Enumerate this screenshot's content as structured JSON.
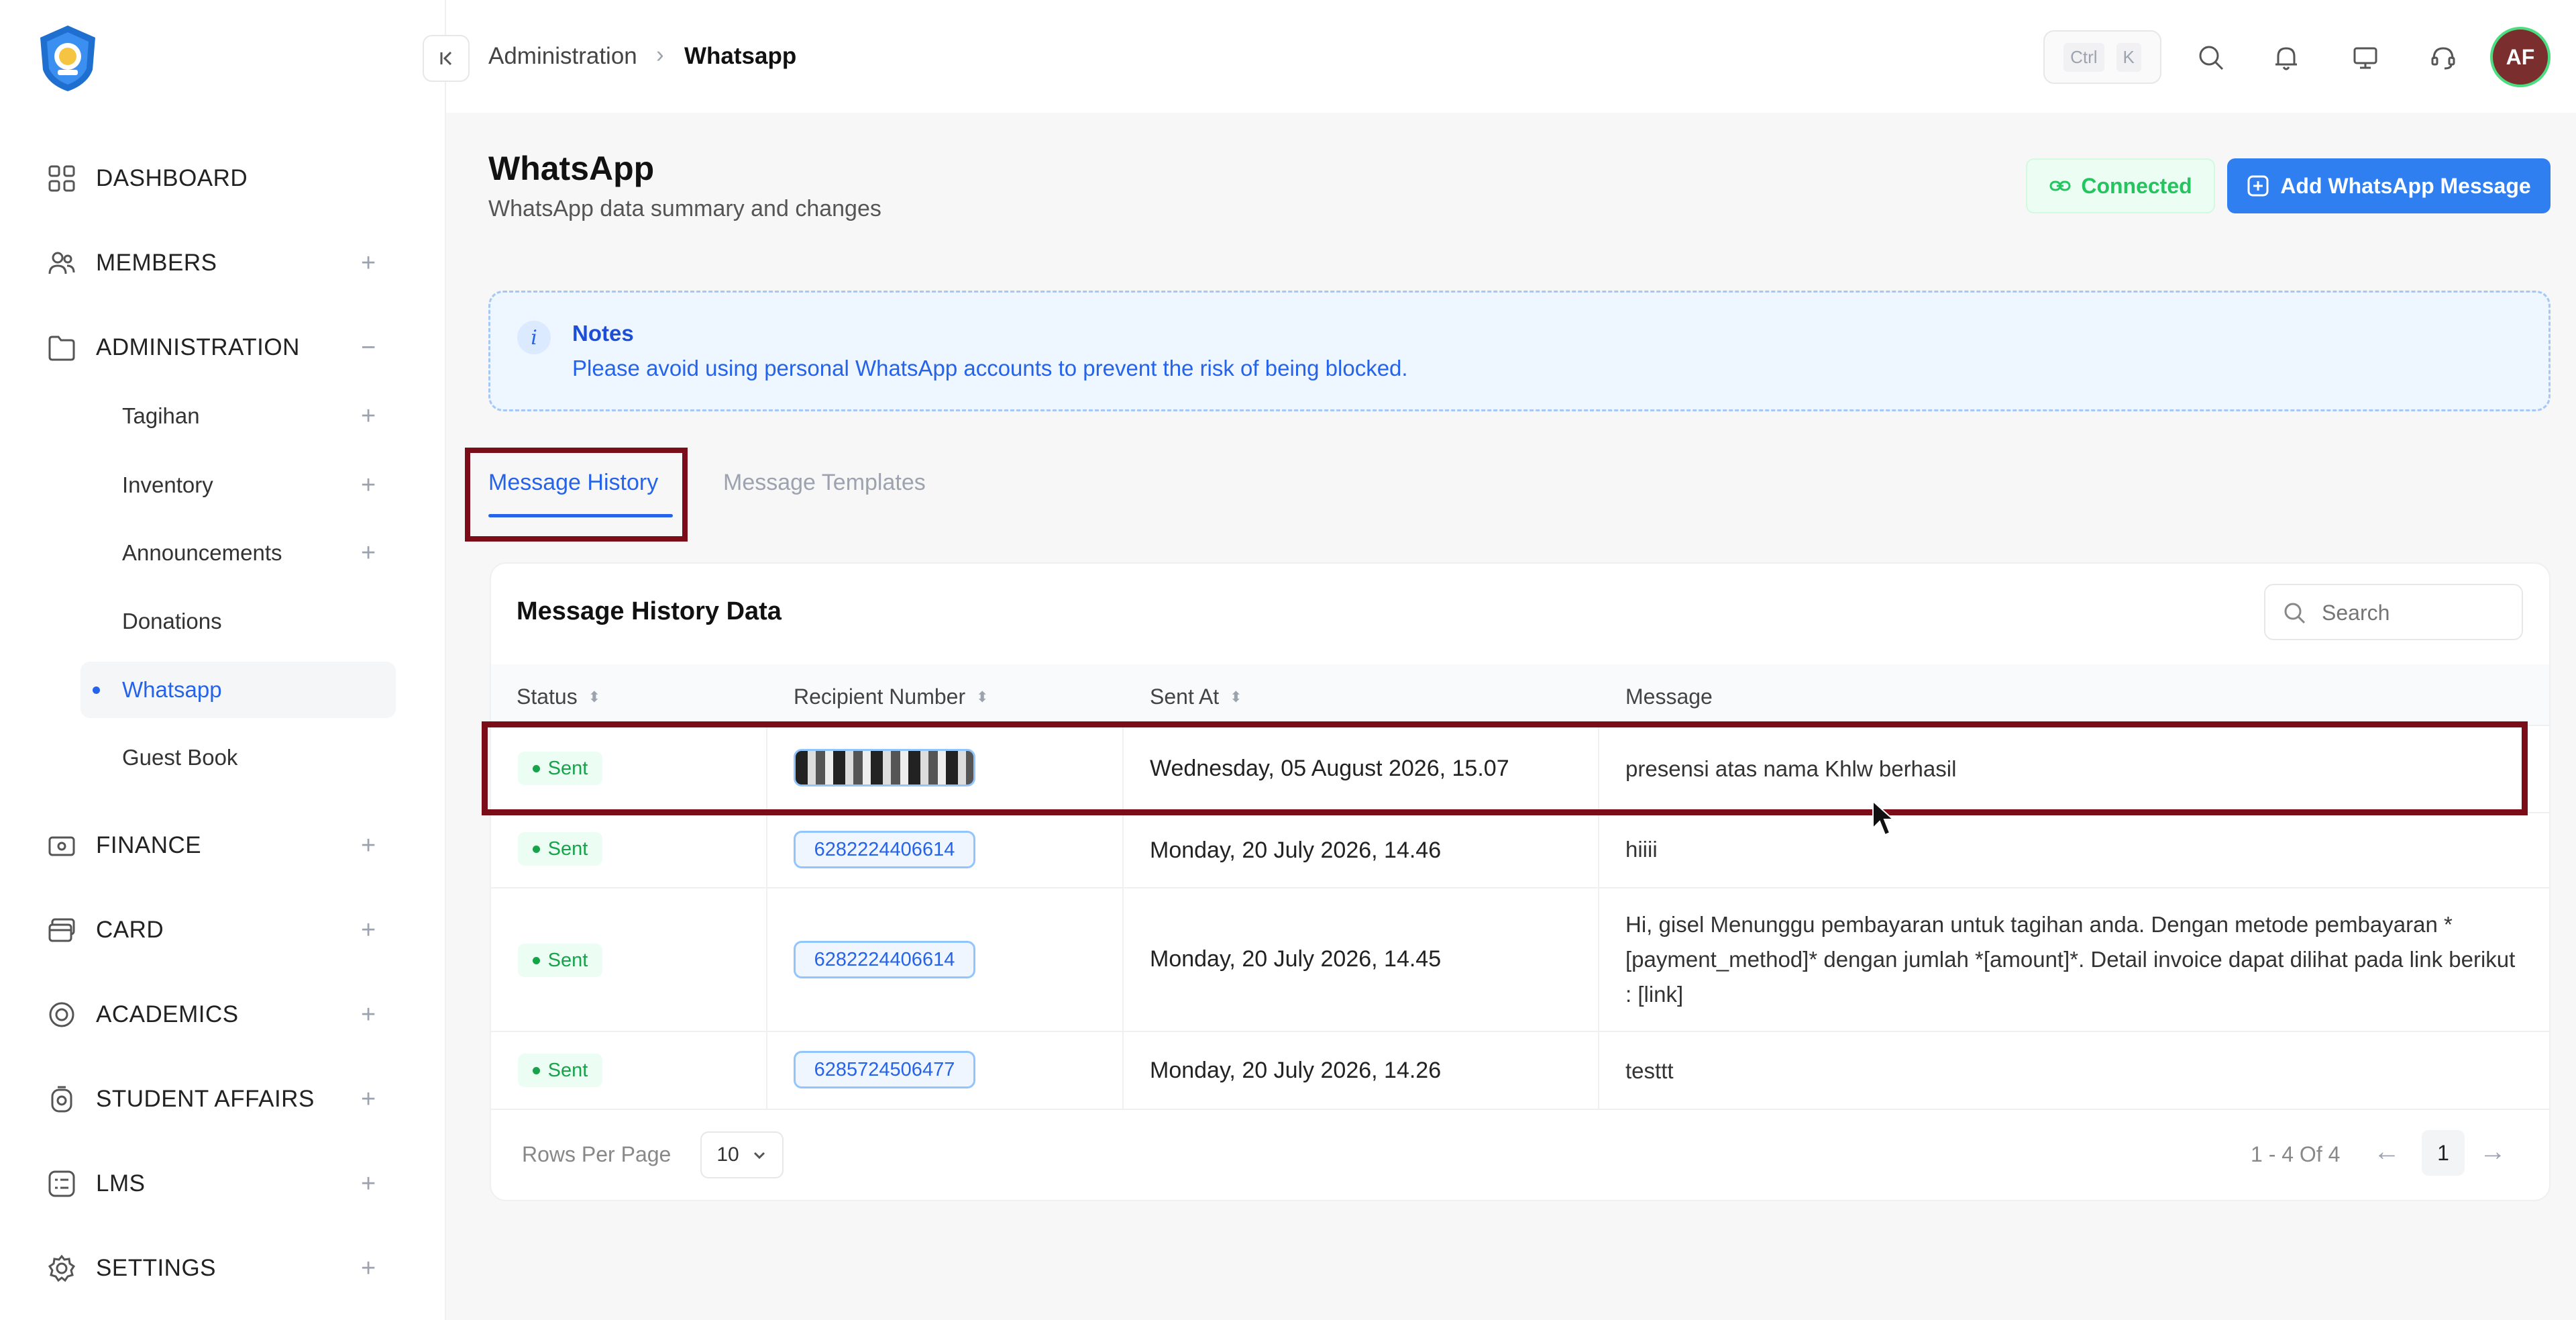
{
  "sidebar": {
    "items": [
      {
        "label": "DASHBOARD",
        "icon": "dashboard-icon"
      },
      {
        "label": "MEMBERS",
        "icon": "members-icon",
        "toggle": "+"
      },
      {
        "label": "ADMINISTRATION",
        "icon": "folder-icon",
        "toggle": "−"
      },
      {
        "label": "FINANCE",
        "icon": "finance-icon",
        "toggle": "+"
      },
      {
        "label": "CARD",
        "icon": "card-icon",
        "toggle": "+"
      },
      {
        "label": "ACADEMICS",
        "icon": "academics-icon",
        "toggle": "+"
      },
      {
        "label": "STUDENT AFFAIRS",
        "icon": "student-affairs-icon",
        "toggle": "+"
      },
      {
        "label": "LMS",
        "icon": "lms-icon",
        "toggle": "+"
      },
      {
        "label": "SETTINGS",
        "icon": "settings-icon",
        "toggle": "+"
      }
    ],
    "sub_items": [
      {
        "label": "Tagihan",
        "toggle": "+"
      },
      {
        "label": "Inventory",
        "toggle": "+"
      },
      {
        "label": "Announcements",
        "toggle": "+"
      },
      {
        "label": "Donations"
      },
      {
        "label": "Whatsapp",
        "active": true
      },
      {
        "label": "Guest Book"
      }
    ]
  },
  "topbar": {
    "breadcrumb": [
      "Administration",
      "Whatsapp"
    ],
    "breadcrumb_sep": "›",
    "shortcut_keys": [
      "Ctrl",
      "K"
    ],
    "avatar_initials": "AF"
  },
  "header": {
    "title": "WhatsApp",
    "subtitle": "WhatsApp data summary and changes",
    "status_label": "Connected",
    "add_button_label": "Add WhatsApp Message"
  },
  "notes": {
    "icon_glyph": "i",
    "title": "Notes",
    "text": "Please avoid using personal WhatsApp accounts to prevent the risk of being blocked."
  },
  "tabs": [
    {
      "label": "Message History",
      "active": true
    },
    {
      "label": "Message Templates",
      "active": false
    }
  ],
  "table": {
    "title": "Message History Data",
    "search_placeholder": "Search",
    "columns": [
      "Status",
      "Recipient Number",
      "Sent At",
      "Message"
    ],
    "rows": [
      {
        "status": "Sent",
        "recipient": "",
        "sent_at": "Wednesday, 05 August 2026, 15.07",
        "message": "presensi atas nama Khlw berhasil"
      },
      {
        "status": "Sent",
        "recipient": "6282224406614",
        "sent_at": "Monday, 20 July 2026, 14.46",
        "message": "hiiii"
      },
      {
        "status": "Sent",
        "recipient": "6282224406614",
        "sent_at": "Monday, 20 July 2026, 14.45",
        "message": "Hi, gisel Menunggu pembayaran untuk tagihan anda. Dengan metode pembayaran *[payment_method]* dengan jumlah *[amount]*. Detail invoice dapat dilihat pada link berikut : [link]"
      },
      {
        "status": "Sent",
        "recipient": "6285724506477",
        "sent_at": "Monday, 20 July 2026, 14.26",
        "message": "testtt"
      }
    ],
    "rows_per_page_label": "Rows Per Page",
    "rows_per_page_value": "10",
    "range_label": "1 - 4 Of 4",
    "current_page": "1",
    "prev_arrow": "←",
    "next_arrow": "→"
  },
  "colors": {
    "accent": "#2563eb",
    "success": "#22c55e",
    "highlight_box": "#7b0d18"
  }
}
